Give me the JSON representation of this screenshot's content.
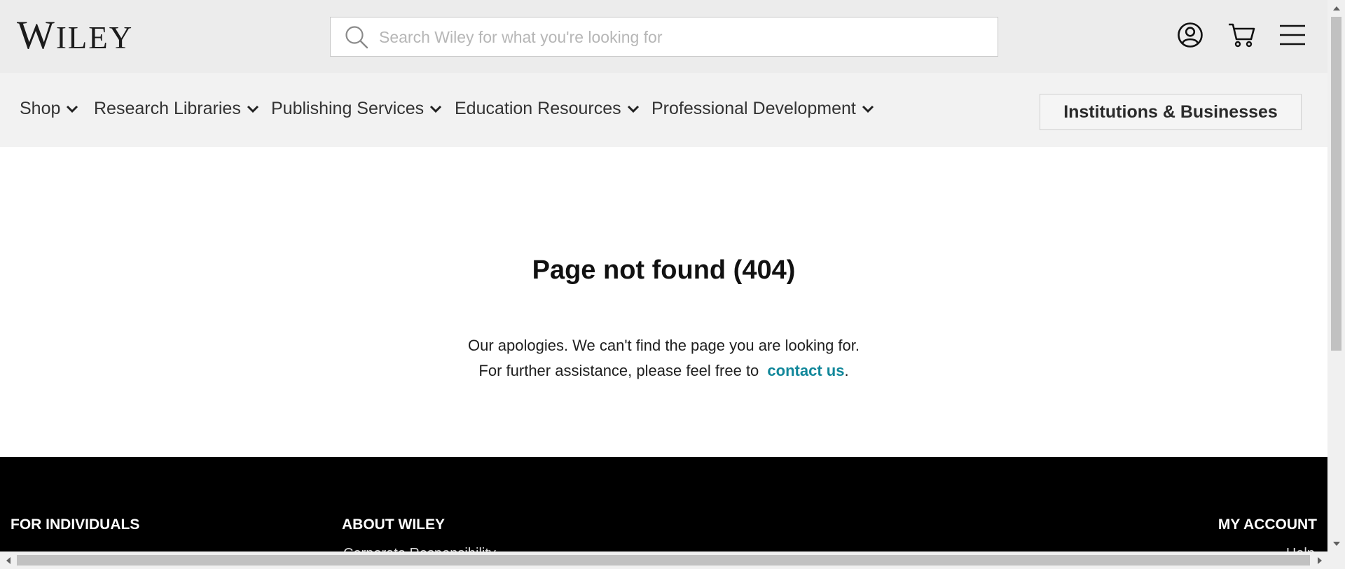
{
  "header": {
    "logo_first": "W",
    "logo_rest": "ILEY",
    "search_placeholder": "Search Wiley for what you're looking for",
    "icons": [
      "search-icon",
      "account-icon",
      "cart-icon",
      "menu-icon"
    ]
  },
  "nav": {
    "items": [
      {
        "label": "Shop"
      },
      {
        "label": "Research Libraries"
      },
      {
        "label": "Publishing Services"
      },
      {
        "label": "Education Resources"
      },
      {
        "label": "Professional Development"
      }
    ],
    "institutions_label": "Institutions & Businesses"
  },
  "main": {
    "title": "Page not found (404)",
    "line1": "Our apologies. We can't find the page you are looking for.",
    "line2_prefix": "For further assistance, please feel free to",
    "contact_label": "contact us",
    "line2_suffix": "."
  },
  "footer": {
    "col1_heading": "FOR INDIVIDUALS",
    "col2_heading": "ABOUT WILEY",
    "col2_link_partial": "Corporate Responsibility",
    "col3_heading": "MY ACCOUNT",
    "col3_link_partial": "Help"
  },
  "colors": {
    "link_teal": "#11879a",
    "header_bg": "#ececec",
    "nav_bg": "#f2f2f2",
    "footer_bg": "#000000"
  }
}
